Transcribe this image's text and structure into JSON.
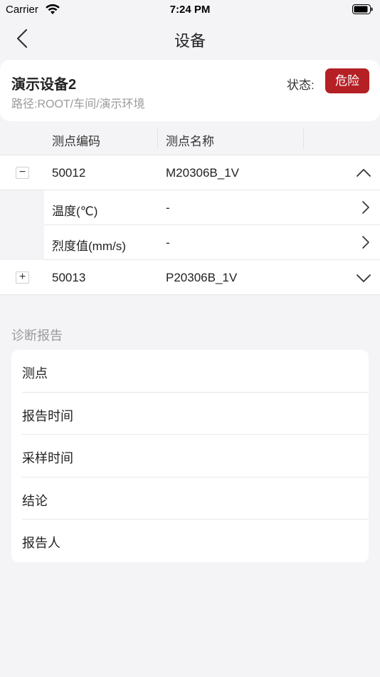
{
  "status_bar": {
    "carrier": "Carrier",
    "time": "7:24 PM"
  },
  "nav": {
    "title": "设备"
  },
  "device": {
    "name": "演示设备2",
    "path": "路径:ROOT/车间/演示环境",
    "status_label": "状态:",
    "status_value": "危险",
    "status_color": "#b52025"
  },
  "table": {
    "headers": [
      "测点编码",
      "测点名称"
    ],
    "rows": [
      {
        "toggle": "−",
        "code": "50012",
        "name": "M20306B_1V",
        "expanded": true,
        "params": [
          {
            "name": "温度(℃)",
            "value": "-"
          },
          {
            "name": "烈度值(mm/s)",
            "value": "-"
          }
        ]
      },
      {
        "toggle": "+",
        "code": "50013",
        "name": "P20306B_1V",
        "expanded": false
      }
    ]
  },
  "report": {
    "section_title": "诊断报告",
    "items": [
      "测点",
      "报告时间",
      "采样时间",
      "结论",
      "报告人"
    ]
  }
}
